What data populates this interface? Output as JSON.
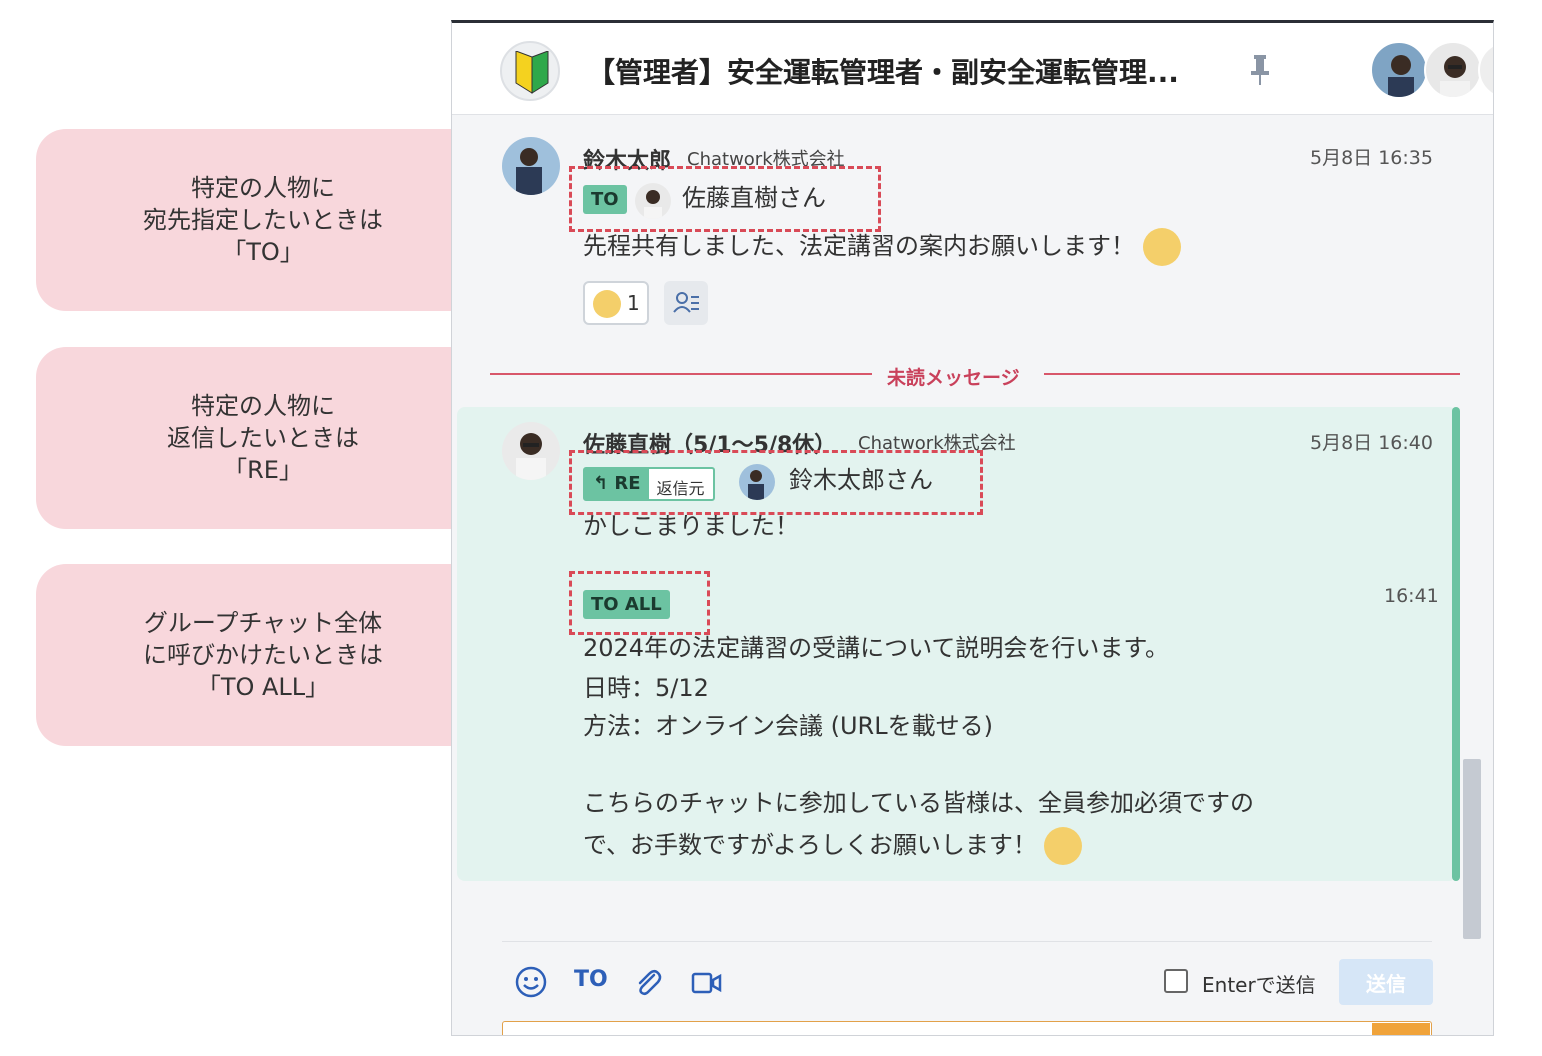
{
  "callouts": [
    {
      "line1": "特定の人物に",
      "line2": "宛先指定したいときは",
      "line3": "「TO」"
    },
    {
      "line1": "特定の人物に",
      "line2": "返信したいときは",
      "line3": "「RE」"
    },
    {
      "line1": "グループチャット全体",
      "line2": "に呼びかけたいときは",
      "line3": "「TO ALL」"
    }
  ],
  "header": {
    "room_title": "【管理者】安全運転管理者・副安全運転管理..."
  },
  "messages": [
    {
      "sender": "鈴木太郎",
      "org": "Chatwork株式会社",
      "time": "5月8日 16:35",
      "to_label": "TO",
      "to_name": "佐藤直樹さん",
      "body": "先程共有しました、法定講習の案内お願いします！",
      "reaction_count": "1"
    },
    {
      "sender": "佐藤直樹（5/1〜5/8休）",
      "org": "Chatwork株式会社",
      "time": "5月8日 16:40",
      "re_label": "RE",
      "re_source": "返信元",
      "re_name": "鈴木太郎さん",
      "body": "かしこまりました！"
    },
    {
      "time": "16:41",
      "to_all_label": "TO ALL",
      "lines": [
        "2024年の法定講習の受講について説明会を行います。",
        "日時：5/12",
        "方法：オンライン会議 (URLを載せる)",
        "",
        "こちらのチャットに参加している皆様は、全員参加必須ですの",
        "で、お手数ですがよろしくお願いします！"
      ]
    }
  ],
  "unread_label": "未読メッセージ",
  "composer": {
    "to_button": "TO",
    "enter_label": "Enterで送信",
    "send_label": "送信"
  },
  "colors": {
    "accent_green": "#6cc3a2",
    "callout_pink": "#f8d7dc",
    "unread_red": "#d8576a"
  }
}
